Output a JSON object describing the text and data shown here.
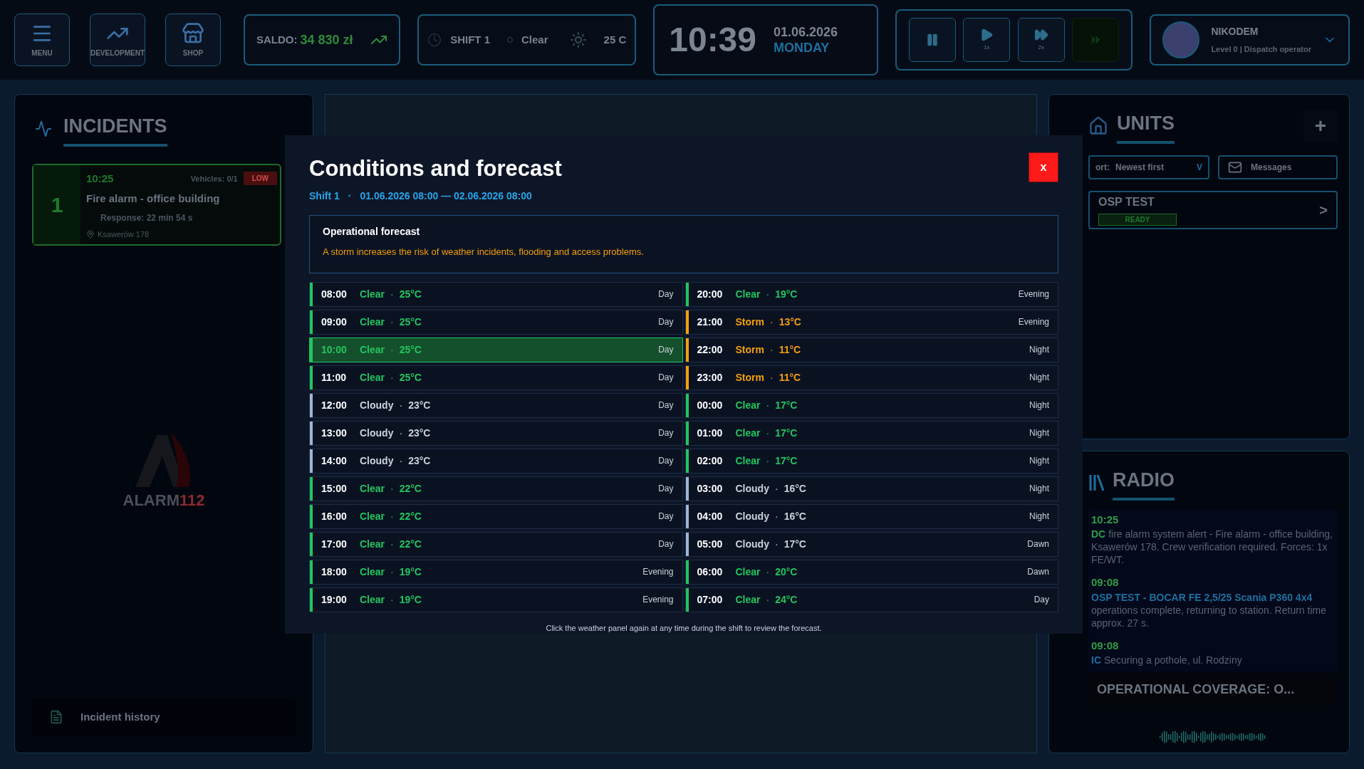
{
  "top_bar": {
    "buttons": [
      {
        "kind": "menu",
        "label": "MENU"
      },
      {
        "kind": "development",
        "label": "DEVELOPMENT"
      },
      {
        "kind": "shop",
        "label": "SHOP"
      }
    ],
    "balance": {
      "label": "SALDO:",
      "value": "34 830 zł"
    },
    "shift": {
      "label": "SHIFT 1",
      "weather": "Clear",
      "temperature": "25 C"
    },
    "clock": {
      "time": "10:39",
      "date": "01.06.2026",
      "weekday": "MONDAY"
    },
    "speed_controls": [
      {
        "kind": "pause"
      },
      {
        "kind": "play",
        "label": "1x"
      },
      {
        "kind": "fast",
        "label": "2x"
      },
      {
        "kind": "locked"
      }
    ],
    "user": {
      "name": "NIKODEM",
      "role": "Level 0 | Dispatch operator"
    }
  },
  "incidents": {
    "title": "INCIDENTS",
    "items": [
      {
        "number": "1",
        "time": "10:25",
        "vehicles": "Vehicles: 0/1",
        "priority": "LOW",
        "title": "Fire alarm - office building",
        "response": "Response: 22 min 54 s",
        "address": "Ksawerów 178"
      }
    ],
    "logo": {
      "name": "ALARM",
      "number": "112"
    },
    "history": "Incident history"
  },
  "units": {
    "title": "UNITS",
    "sort_label": "ort:",
    "sort_value": "Newest first",
    "sort_caret": "V",
    "messages": "Messages",
    "add": "+",
    "items": [
      {
        "name": "OSP TEST",
        "status": "READY",
        "arrow": ">"
      }
    ]
  },
  "radio": {
    "title": "RADIO",
    "messages": [
      {
        "time": "10:25",
        "speaker": "DC",
        "color": "#2f9e44",
        "text": "fire alarm system alert - Fire alarm - office building, Ksawerów 178. Crew verification required. Forces: 1x FE/WT."
      },
      {
        "time": "09:08",
        "speaker": "OSP TEST - BOCAR FE 2,5/25 Scania P360 4x4",
        "color": "#1f6f9e",
        "text": "operations complete, returning to station. Return time approx. 27 s."
      },
      {
        "time": "09:08",
        "speaker": "IC",
        "color": "#1f6f9e",
        "text": "Securing a pothole, ul. Rodziny"
      }
    ],
    "coverage": "OPERATIONAL COVERAGE: O..."
  },
  "modal": {
    "title": "Conditions and forecast",
    "shift": "Shift 1",
    "separator": "·",
    "period": "01.06.2026 08:00 — 02.06.2026 08:00",
    "close": "x",
    "forecast": {
      "title": "Operational forecast",
      "text": "A storm increases the risk of weather incidents, flooding and access problems."
    },
    "columns": [
      [
        {
          "time": "08:00",
          "kind": "clear",
          "condition": "Clear",
          "temperature": "25°C",
          "phase": "Day",
          "selected": false
        },
        {
          "time": "09:00",
          "kind": "clear",
          "condition": "Clear",
          "temperature": "25°C",
          "phase": "Day",
          "selected": false
        },
        {
          "time": "10:00",
          "kind": "clear",
          "condition": "Clear",
          "temperature": "25°C",
          "phase": "Day",
          "selected": true
        },
        {
          "time": "11:00",
          "kind": "clear",
          "condition": "Clear",
          "temperature": "25°C",
          "phase": "Day",
          "selected": false
        },
        {
          "time": "12:00",
          "kind": "cloudy",
          "condition": "Cloudy",
          "temperature": "23°C",
          "phase": "Day",
          "selected": false
        },
        {
          "time": "13:00",
          "kind": "cloudy",
          "condition": "Cloudy",
          "temperature": "23°C",
          "phase": "Day",
          "selected": false
        },
        {
          "time": "14:00",
          "kind": "cloudy",
          "condition": "Cloudy",
          "temperature": "23°C",
          "phase": "Day",
          "selected": false
        },
        {
          "time": "15:00",
          "kind": "clear",
          "condition": "Clear",
          "temperature": "22°C",
          "phase": "Day",
          "selected": false
        },
        {
          "time": "16:00",
          "kind": "clear",
          "condition": "Clear",
          "temperature": "22°C",
          "phase": "Day",
          "selected": false
        },
        {
          "time": "17:00",
          "kind": "clear",
          "condition": "Clear",
          "temperature": "22°C",
          "phase": "Day",
          "selected": false
        },
        {
          "time": "18:00",
          "kind": "clear",
          "condition": "Clear",
          "temperature": "19°C",
          "phase": "Evening",
          "selected": false
        },
        {
          "time": "19:00",
          "kind": "clear",
          "condition": "Clear",
          "temperature": "19°C",
          "phase": "Evening",
          "selected": false
        }
      ],
      [
        {
          "time": "20:00",
          "kind": "clear",
          "condition": "Clear",
          "temperature": "19°C",
          "phase": "Evening",
          "selected": false
        },
        {
          "time": "21:00",
          "kind": "storm",
          "condition": "Storm",
          "temperature": "13°C",
          "phase": "Evening",
          "selected": false
        },
        {
          "time": "22:00",
          "kind": "storm",
          "condition": "Storm",
          "temperature": "11°C",
          "phase": "Night",
          "selected": false
        },
        {
          "time": "23:00",
          "kind": "storm",
          "condition": "Storm",
          "temperature": "11°C",
          "phase": "Night",
          "selected": false
        },
        {
          "time": "00:00",
          "kind": "clear",
          "condition": "Clear",
          "temperature": "17°C",
          "phase": "Night",
          "selected": false
        },
        {
          "time": "01:00",
          "kind": "clear",
          "condition": "Clear",
          "temperature": "17°C",
          "phase": "Night",
          "selected": false
        },
        {
          "time": "02:00",
          "kind": "clear",
          "condition": "Clear",
          "temperature": "17°C",
          "phase": "Night",
          "selected": false
        },
        {
          "time": "03:00",
          "kind": "cloudy",
          "condition": "Cloudy",
          "temperature": "16°C",
          "phase": "Night",
          "selected": false
        },
        {
          "time": "04:00",
          "kind": "cloudy",
          "condition": "Cloudy",
          "temperature": "16°C",
          "phase": "Night",
          "selected": false
        },
        {
          "time": "05:00",
          "kind": "cloudy",
          "condition": "Cloudy",
          "temperature": "17°C",
          "phase": "Dawn",
          "selected": false
        },
        {
          "time": "06:00",
          "kind": "clear",
          "condition": "Clear",
          "temperature": "20°C",
          "phase": "Dawn",
          "selected": false
        },
        {
          "time": "07:00",
          "kind": "clear",
          "condition": "Clear",
          "temperature": "24°C",
          "phase": "Day",
          "selected": false
        }
      ]
    ],
    "note": "Click the weather panel again at any time during the shift to review the forecast."
  }
}
